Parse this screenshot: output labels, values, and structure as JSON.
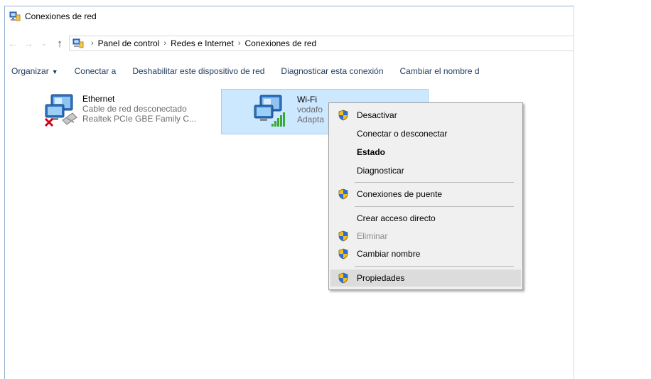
{
  "window": {
    "title": "Conexiones de red"
  },
  "address": {
    "crumbs": [
      "Panel de control",
      "Redes e Internet",
      "Conexiones de red"
    ]
  },
  "nav": {
    "back": "←",
    "forward": "→",
    "recent": "⌄",
    "up": "↑"
  },
  "toolbar": {
    "organizar": "Organizar",
    "conectar": "Conectar a",
    "deshabilitar": "Deshabilitar este dispositivo de red",
    "diagnosticar": "Diagnosticar esta conexión",
    "renombrar": "Cambiar el nombre d"
  },
  "connections": [
    {
      "name": "Ethernet",
      "status": "Cable de red desconectado",
      "adapter": "Realtek PCIe GBE Family C..."
    },
    {
      "name": "Wi-Fi",
      "status": "vodafo",
      "adapter": "Adapta"
    }
  ],
  "context_menu": {
    "items": [
      {
        "label": "Desactivar",
        "shield": true
      },
      {
        "label": "Conectar o desconectar",
        "shield": false
      },
      {
        "label": "Estado",
        "shield": false,
        "bold": true
      },
      {
        "label": "Diagnosticar",
        "shield": false
      },
      {
        "label": "Conexiones de puente",
        "shield": true
      },
      {
        "label": "Crear acceso directo",
        "shield": false
      },
      {
        "label": "Eliminar",
        "shield": true,
        "disabled": true
      },
      {
        "label": "Cambiar nombre",
        "shield": true
      },
      {
        "label": "Propiedades",
        "shield": true,
        "highlighted": true
      }
    ]
  },
  "colors": {
    "selection": "#cce8ff",
    "selection_border": "#99d1ff",
    "menu_bg": "#f0f0f0",
    "menu_hover": "#dcdcdc"
  }
}
